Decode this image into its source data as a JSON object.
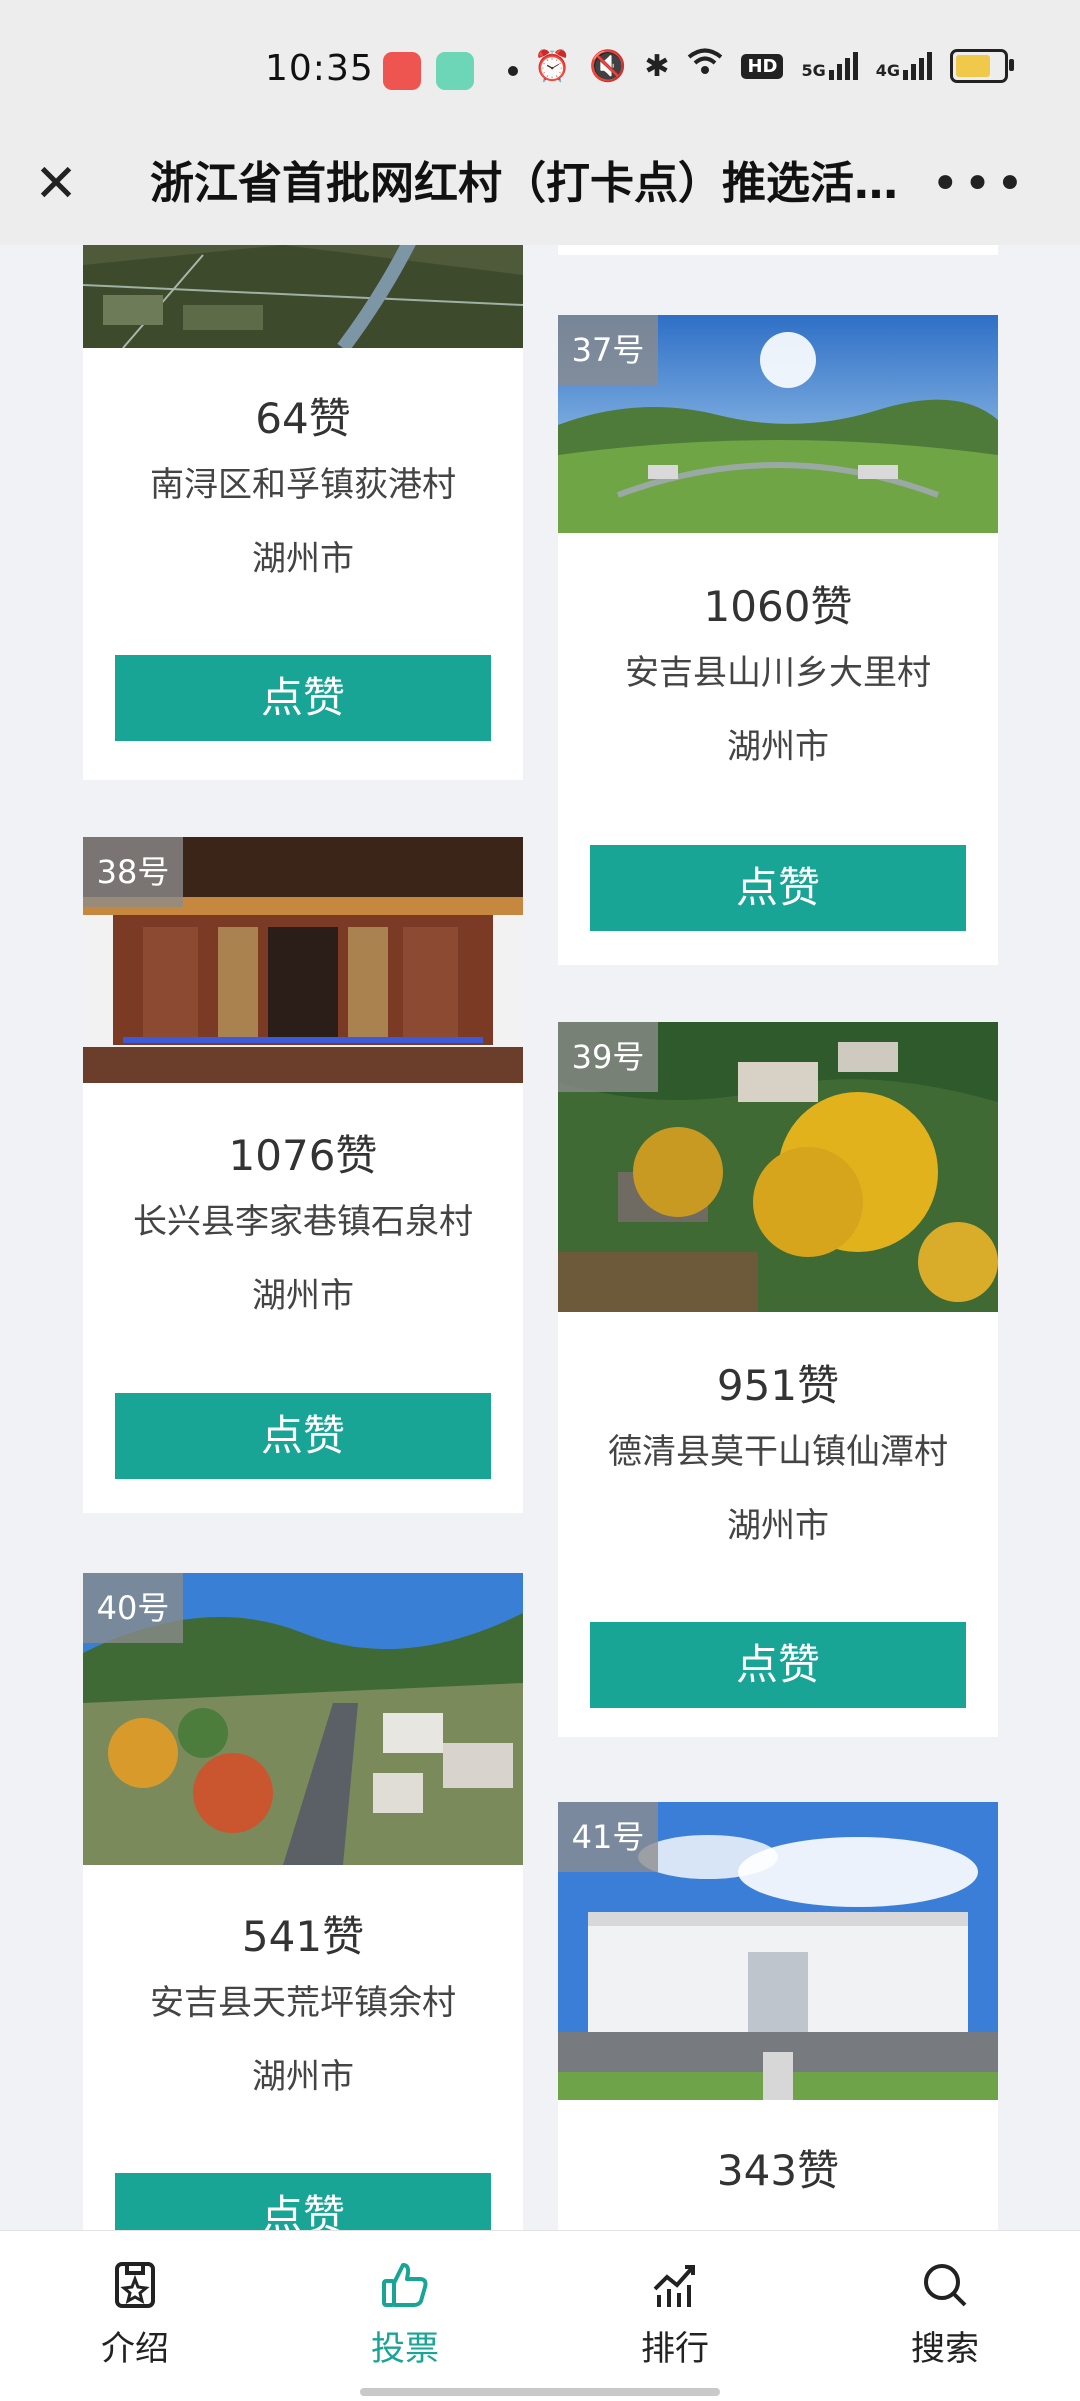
{
  "status_bar": {
    "time": "10:35",
    "hd_label": "HD",
    "net1": "5G",
    "net2": "4G"
  },
  "header": {
    "title": "浙江省首批网红村（打卡点）推选活…",
    "close_icon": "close-icon",
    "more_icon": "more-icon"
  },
  "cards": [
    {
      "number": "",
      "likes": "64赞",
      "name": "南浔区和孚镇荻港村",
      "city": "湖州市",
      "button": "点赞"
    },
    {
      "number": "37号",
      "likes": "1060赞",
      "name": "安吉县山川乡大里村",
      "city": "湖州市",
      "button": "点赞"
    },
    {
      "number": "38号",
      "likes": "1076赞",
      "name": "长兴县李家巷镇石泉村",
      "city": "湖州市",
      "button": "点赞"
    },
    {
      "number": "39号",
      "likes": "951赞",
      "name": "德清县莫干山镇仙潭村",
      "city": "湖州市",
      "button": "点赞"
    },
    {
      "number": "40号",
      "likes": "541赞",
      "name": "安吉县天荒坪镇余村",
      "city": "湖州市",
      "button": "点赞"
    },
    {
      "number": "41号",
      "likes": "343赞",
      "name": "",
      "city": "",
      "button": ""
    }
  ],
  "tabs": [
    {
      "label": "介绍",
      "icon": "intro-icon"
    },
    {
      "label": "投票",
      "icon": "thumbs-up-icon"
    },
    {
      "label": "排行",
      "icon": "ranking-icon"
    },
    {
      "label": "搜索",
      "icon": "search-icon"
    }
  ],
  "colors": {
    "accent": "#18a596",
    "background": "#f1f2f6"
  }
}
